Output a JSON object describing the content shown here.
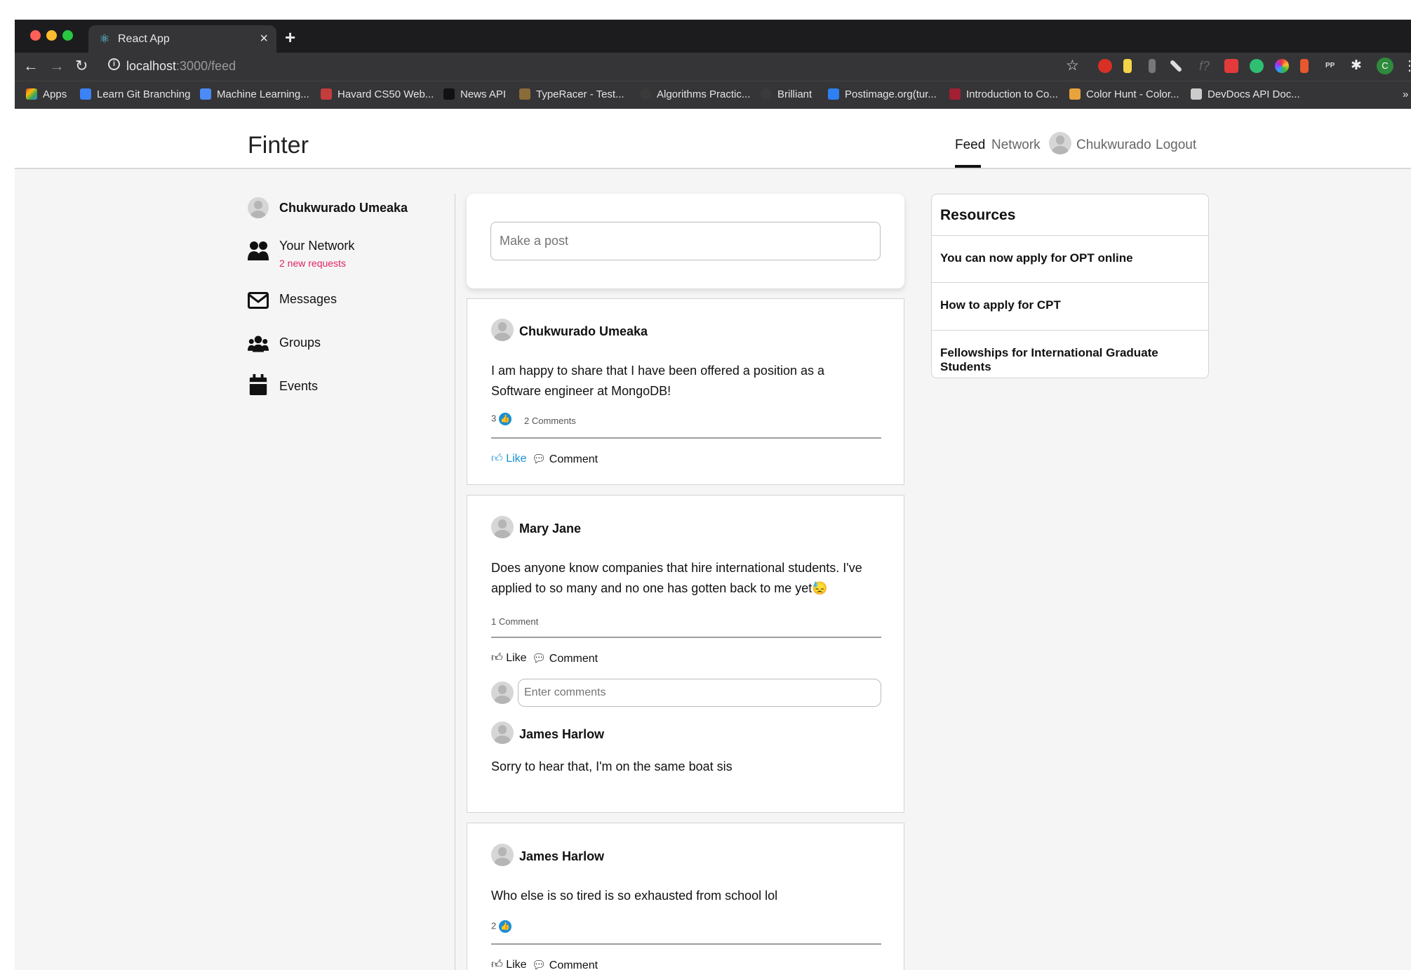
{
  "browser": {
    "tab_title": "React App",
    "url_host": "localhost",
    "url_path": ":3000/feed",
    "profile_initial": "C"
  },
  "bookmarks": [
    {
      "label": "Apps",
      "color": "#e94235"
    },
    {
      "label": "Learn Git Branching",
      "color": "#3b82f6"
    },
    {
      "label": "Machine Learning...",
      "color": "#4c8bf5"
    },
    {
      "label": "Havard CS50 Web...",
      "color": "#c43c3c"
    },
    {
      "label": "News API",
      "color": "#111111"
    },
    {
      "label": "TypeRacer - Test...",
      "color": "#8b6b3a"
    },
    {
      "label": "Algorithms Practic...",
      "color": "#3a3a3a"
    },
    {
      "label": "Brilliant",
      "color": "#3a3a3a"
    },
    {
      "label": "Postimage.org(tur...",
      "color": "#2e7ff0"
    },
    {
      "label": "Introduction to Co...",
      "color": "#a31f34"
    },
    {
      "label": "Color Hunt - Color...",
      "color": "#e8a33d"
    },
    {
      "label": "DevDocs API Doc...",
      "color": "#cccccc"
    }
  ],
  "app": {
    "brand": "Finter",
    "nav": {
      "feed": "Feed",
      "network": "Network",
      "user": "Chukwurado",
      "logout": "Logout"
    }
  },
  "sidebar": {
    "user_name": "Chukwurado Umeaka",
    "network_label": "Your Network",
    "network_requests": "2 new requests",
    "messages_label": "Messages",
    "groups_label": "Groups",
    "events_label": "Events",
    "requests_color": "#e0245e"
  },
  "composer": {
    "placeholder": "Make a post"
  },
  "posts": [
    {
      "author": "Chukwurado Umeaka",
      "body": "I am happy to share that I have been offered a position as a Software engineer at MongoDB!",
      "likes": "3",
      "comments_count": "2 Comments",
      "like_label": "Like",
      "comment_label": "Comment"
    },
    {
      "author": "Mary Jane",
      "body": "Does anyone know companies that hire international students. I've applied to so many and no one has gotten back to me yet",
      "emoji": "😓",
      "comments_count": "1 Comment",
      "like_label": "Like",
      "comment_label": "Comment",
      "comment_placeholder": "Enter comments",
      "comment": {
        "author": "James Harlow",
        "text": "Sorry to hear that, I'm on the same boat sis"
      }
    },
    {
      "author": "James Harlow",
      "body": "Who else is so tired is so exhausted from school lol",
      "likes": "2",
      "like_label": "Like",
      "comment_label": "Comment"
    }
  ],
  "resources": {
    "title": "Resources",
    "items": [
      "You can now apply for OPT online",
      "How to apply for CPT",
      "Fellowships for International Graduate Students"
    ]
  }
}
